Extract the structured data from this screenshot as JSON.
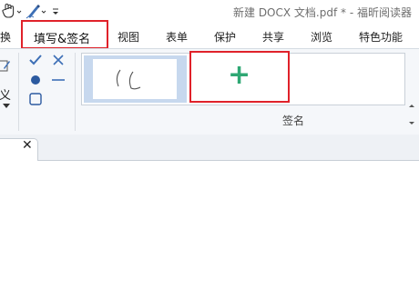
{
  "window": {
    "title": "新建 DOCX 文档.pdf * - 福昕阅读器"
  },
  "tabs": [
    {
      "label": "换"
    },
    {
      "label": "填写&签名",
      "active": true
    },
    {
      "label": "视图"
    },
    {
      "label": "表单"
    },
    {
      "label": "保护"
    },
    {
      "label": "共享"
    },
    {
      "label": "浏览"
    },
    {
      "label": "特色功能"
    }
  ],
  "ribbon": {
    "left_partial_label": "义",
    "group_label": "签名",
    "add_signature_symbol": "+"
  },
  "doc_tab": {
    "close_symbol": "✕"
  },
  "colors": {
    "highlight": "#e0222a",
    "accent_green": "#2fa874",
    "selection": "#c7d8ee"
  }
}
